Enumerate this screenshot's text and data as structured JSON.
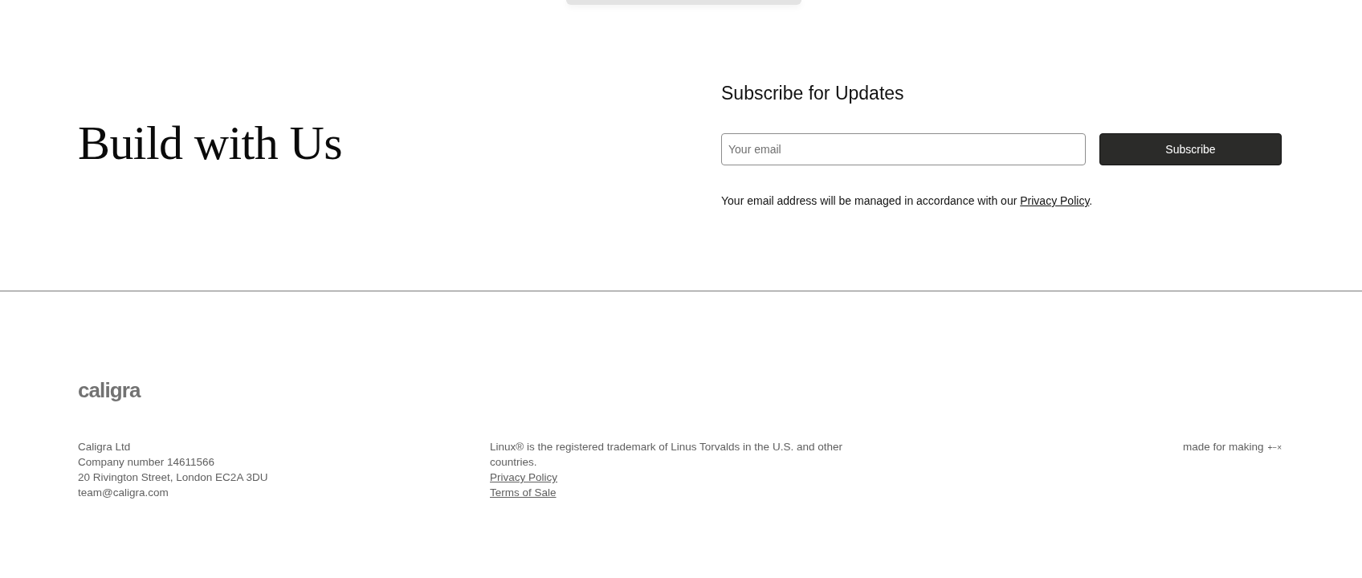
{
  "heading": "Build with Us",
  "subscribe": {
    "title": "Subscribe for Updates",
    "email_field": {
      "placeholder": "Your email"
    },
    "button": "Subscribe",
    "note": {
      "text_before": "Your email address will be managed in accordance with our ",
      "link": "Privacy Policy",
      "text_after": "."
    }
  },
  "footer": {
    "logo": "caligra",
    "company": [
      "Caligra Ltd",
      "Company number 14611566",
      "20 Rivington Street, London EC2A 3DU",
      "team@caligra.com"
    ],
    "legal": {
      "trademark": "Linux® is the registered trademark of Linus Torvalds in the U.S. and other countries.",
      "links": [
        "Privacy Policy",
        "Terms of Sale"
      ]
    },
    "tagline": "made for making",
    "tagline_mark": "+−×"
  }
}
